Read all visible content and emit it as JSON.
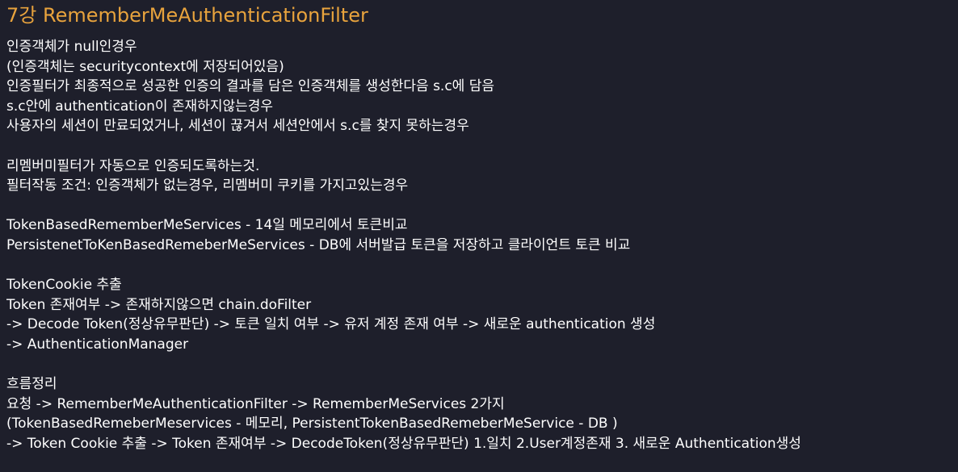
{
  "document": {
    "title": "7강 RememberMeAuthenticationFilter",
    "sections": [
      {
        "lines": [
          "인증객체가 null인경우",
          "(인증객체는 securitycontext에 저장되어있음)",
          "인증필터가 최종적으로 성공한 인증의 결과를 담은 인증객체를 생성한다음 s.c에 담음",
          "s.c안에 authentication이 존재하지않는경우",
          "사용자의 세션이 만료되었거나, 세션이 끊겨서 세션안에서 s.c를 찾지 못하는경우"
        ]
      },
      {
        "lines": [
          "리멤버미필터가 자동으로 인증되도록하는것.",
          "필터작동 조건: 인증객체가 없는경우, 리멤버미 쿠키를 가지고있는경우"
        ]
      },
      {
        "lines": [
          "TokenBasedRememberMeServices - 14일 메모리에서 토큰비교",
          "PersistenetToKenBasedRemeberMeServices - DB에 서버발급 토큰을 저장하고 클라이언트 토큰 비교"
        ]
      },
      {
        "lines": [
          "TokenCookie 추출",
          "Token 존재여부 -> 존재하지않으면 chain.doFilter",
          "-> Decode Token(정상유무판단) -> 토큰 일치 여부 -> 유저 계정 존재 여부 -> 새로운 authentication 생성",
          "-> AuthenticationManager"
        ]
      },
      {
        "lines": [
          "흐름정리",
          "요청 -> RememberMeAuthenticationFilter -> RememberMeServices 2가지",
          "(TokenBasedRemeberMeservices - 메모리, PersistentTokenBasedRemeberMeService - DB )",
          "-> Token Cookie 추출 -> Token 존재여부 -> DecodeToken(정상유무판단) 1.일치 2.User계정존재 3. 새로운 Authentication생성"
        ]
      }
    ]
  },
  "colors": {
    "background": "#1e1f2b",
    "title": "#e8a33d",
    "text": "#ffffff"
  }
}
